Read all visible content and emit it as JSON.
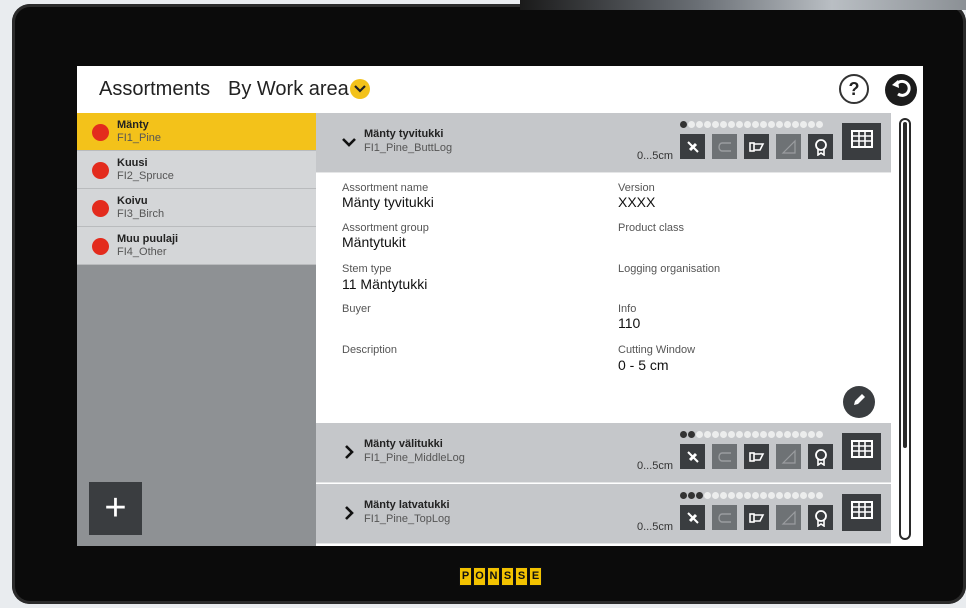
{
  "header": {
    "title": "Assortments",
    "view_label": "By Work area",
    "help_label": "?"
  },
  "sidebar": {
    "items": [
      {
        "name": "Mänty",
        "code": "FI1_Pine",
        "selected": true
      },
      {
        "name": "Kuusi",
        "code": "FI2_Spruce"
      },
      {
        "name": "Koivu",
        "code": "FI3_Birch"
      },
      {
        "name": "Muu puulaji",
        "code": "FI4_Other"
      }
    ],
    "add_label": "+"
  },
  "rows": [
    {
      "name": "Mänty tyvitukki",
      "code": "FI1_Pine_ButtLog",
      "range": "0...5cm",
      "expanded": true,
      "active_dots": 1
    },
    {
      "name": "Mänty välitukki",
      "code": "FI1_Pine_MiddleLog",
      "range": "0...5cm",
      "expanded": false,
      "active_dots": 2
    },
    {
      "name": "Mänty latvatukki",
      "code": "FI1_Pine_TopLog",
      "range": "0...5cm",
      "expanded": false,
      "active_dots": 3
    }
  ],
  "detail": {
    "assortment_name_label": "Assortment name",
    "assortment_name": "Mänty tyvitukki",
    "version_label": "Version",
    "version": "XXXX",
    "assortment_group_label": "Assortment group",
    "assortment_group": "Mäntytukit",
    "product_class_label": "Product class",
    "stem_type_label": "Stem type",
    "stem_type": "11 Mäntytukki",
    "logging_org_label": "Logging organisation",
    "buyer_label": "Buyer",
    "info_label": "Info",
    "info": "110",
    "description_label": "Description",
    "cutting_window_label": "Cutting Window",
    "cutting_window": "0 - 5 cm"
  },
  "brand": {
    "logo_letters": [
      "P",
      "O",
      "N",
      "S",
      "S",
      "E"
    ]
  },
  "colors": {
    "accent": "#f3c21a",
    "species_dot": "#e32b1d",
    "dark": "#3a3d40"
  }
}
